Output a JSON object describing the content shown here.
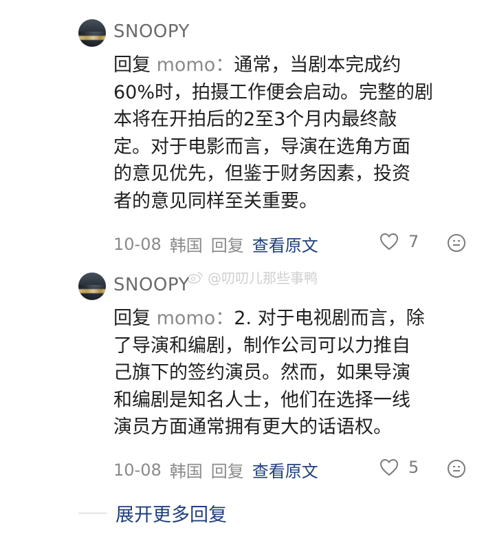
{
  "comments": [
    {
      "username": "SNOOPY",
      "reply_prefix": "回复",
      "mention": "momo：",
      "text": "通常，当剧本完成约\n60%时，拍摄工作便会启动。完整的剧\n本将在开拍后的2至3个月内最终敲\n定。对于电影而言，导演在选角方面\n的意见优先，但鉴于财务因素，投资\n者的意见同样至关重要。",
      "date": "10-08",
      "location": "韩国",
      "reply_label": "回复",
      "view_original_label": "查看原文",
      "likes": "7"
    },
    {
      "username": "SNOOPY",
      "reply_prefix": "回复",
      "mention": "momo：",
      "text": "2. 对于电视剧而言，除\n了导演和编剧，制作公司可以力推自\n己旗下的签约演员。然而，如果导演\n和编剧是知名人士，他们在选择一线\n演员方面通常拥有更大的话语权。",
      "date": "10-08",
      "location": "韩国",
      "reply_label": "回复",
      "view_original_label": "查看原文",
      "likes": "5"
    }
  ],
  "watermark": "@叨叨儿那些事鸭",
  "expand_label": "展开更多回复",
  "colors": {
    "link": "#1f3f7a",
    "muted": "#8a8a8a",
    "text": "#1f1f1f"
  },
  "icons": {
    "like": "heart-outline-icon",
    "emoji": "smiley-face-icon",
    "watermark": "weibo-icon"
  }
}
